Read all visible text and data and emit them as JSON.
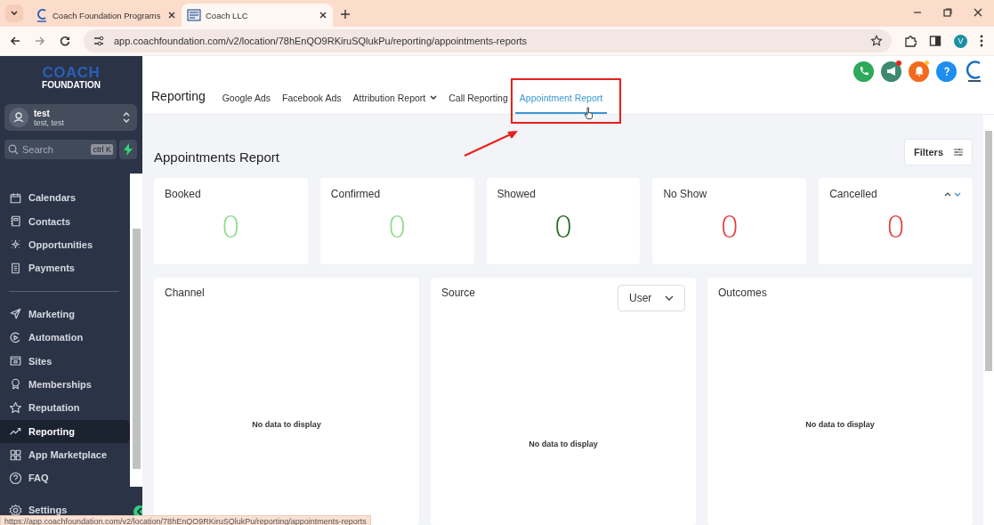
{
  "browser": {
    "tabs": [
      {
        "title": "Coach Foundation Programs",
        "selected": false
      },
      {
        "title": "Coach LLC",
        "selected": true
      }
    ],
    "url": "app.coachfoundation.com/v2/location/78hEnQO9RKiruSQlukPu/reporting/appointments-reports",
    "profile_initial": "V"
  },
  "sidebar": {
    "logo": {
      "line1": "COACH",
      "line2": "FOUNDATION"
    },
    "account": {
      "name": "test",
      "subtitle": "test, test"
    },
    "search": {
      "placeholder": "Search",
      "shortcut": "ctrl K"
    },
    "groups": [
      [
        {
          "label": "Calendars",
          "selected": false
        },
        {
          "label": "Contacts",
          "selected": false
        },
        {
          "label": "Opportunities",
          "selected": false
        },
        {
          "label": "Payments",
          "selected": false
        }
      ],
      [
        {
          "label": "Marketing",
          "selected": false
        },
        {
          "label": "Automation",
          "selected": false
        },
        {
          "label": "Sites",
          "selected": false
        },
        {
          "label": "Memberships",
          "selected": false
        },
        {
          "label": "Reputation",
          "selected": false
        },
        {
          "label": "Reporting",
          "selected": true
        },
        {
          "label": "App Marketplace",
          "selected": false
        },
        {
          "label": "FAQ",
          "selected": false
        }
      ]
    ],
    "settings": "Settings"
  },
  "header": {
    "title": "Reporting",
    "tabs": [
      {
        "label": "Google Ads",
        "selected": false,
        "has_menu": false
      },
      {
        "label": "Facebook Ads",
        "selected": false,
        "has_menu": false
      },
      {
        "label": "Attribution Report",
        "selected": false,
        "has_menu": true
      },
      {
        "label": "Call Reporting",
        "selected": false,
        "has_menu": false
      },
      {
        "label": "Appointment Report",
        "selected": true,
        "has_menu": false
      }
    ]
  },
  "report": {
    "title": "Appointments Report",
    "filters_button": "Filters",
    "stats": [
      {
        "label": "Booked",
        "value": "0",
        "color": "#8edc8a",
        "sort_arrows": false
      },
      {
        "label": "Confirmed",
        "value": "0",
        "color": "#8edc8a",
        "sort_arrows": false
      },
      {
        "label": "Showed",
        "value": "0",
        "color": "#1e6b1e",
        "sort_arrows": false
      },
      {
        "label": "No Show",
        "value": "0",
        "color": "#e0403f",
        "sort_arrows": false
      },
      {
        "label": "Cancelled",
        "value": "0",
        "color": "#e0403f",
        "sort_arrows": true
      }
    ],
    "panels": [
      {
        "title": "Channel",
        "empty_text": "No data to display"
      },
      {
        "title": "Source",
        "dropdown": "User",
        "empty_text": "No data to display"
      },
      {
        "title": "Outcomes",
        "empty_text": "No data to display"
      }
    ]
  },
  "status_url": "https://app.coachfoundation.com/v2/location/78hEnQO9RKiruSQlukPu/reporting/appointments-reports"
}
